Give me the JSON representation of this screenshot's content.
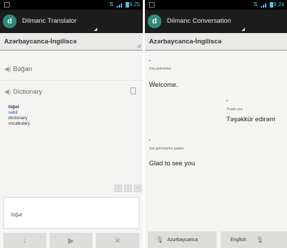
{
  "colors": {
    "statusbar": "#000000",
    "actionbar": "#1d1d1d",
    "app_icon": "#2e8b7a",
    "status_icons": "#4fc3d9",
    "link": "#1a4fd0",
    "background": "#f4f4f2"
  },
  "left": {
    "status_time": "09:25",
    "app_title": "Dilmanc Translator",
    "language_pair": "Azərbaycanca-İngiliscə",
    "input_echo": "Bəğan",
    "dictionary_label": "Dictionary",
    "dictionary": {
      "headword": "lüğət",
      "items": [
        "sabit",
        "dictionary",
        "vocabulary"
      ]
    },
    "mini_buttons": [
      "↑",
      "↓",
      "−"
    ],
    "input_value": "lüğət",
    "buttons": [
      {
        "name": "microphone-icon",
        "glyph": "↓"
      },
      {
        "name": "play-icon",
        "glyph": "▶"
      },
      {
        "name": "close-icon",
        "glyph": "✕"
      }
    ]
  },
  "right": {
    "status_time": "09:24",
    "app_title": "Dilmanc Conversation",
    "language_pair": "Azərbaycanca-İngiliscə",
    "messages": [
      {
        "label": "Xoş gəlmisiniz",
        "text": "Welcome."
      },
      {
        "label": "Thank you",
        "text": "Təşəkkür edirəm"
      },
      {
        "label": "Sizi görməyimə şadam",
        "text": "Glad to see you"
      }
    ],
    "left_language": "Azərbaycanca",
    "right_language": "English"
  }
}
